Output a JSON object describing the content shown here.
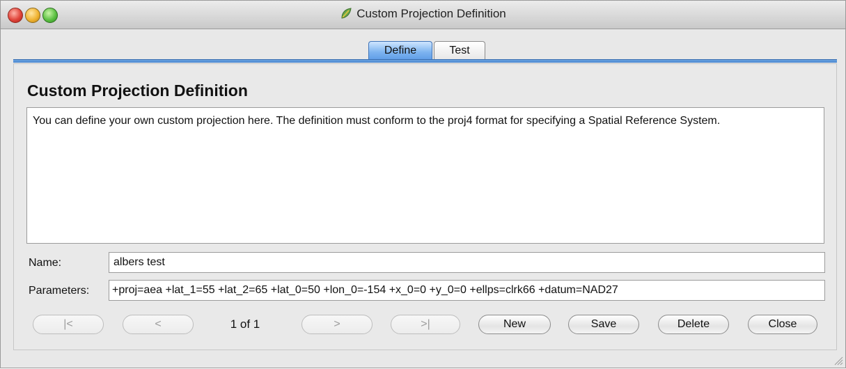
{
  "window": {
    "title": "Custom Projection Definition",
    "icon": "qgis-leaf-icon"
  },
  "tabs": [
    {
      "label": "Define",
      "selected": true
    },
    {
      "label": "Test",
      "selected": false
    }
  ],
  "heading": "Custom Projection Definition",
  "description": "You can define your own custom projection here. The definition must conform to the proj4 format for specifying a Spatial Reference System.",
  "fields": {
    "name_label": "Name:",
    "name_value": "albers test",
    "params_label": "Parameters:",
    "params_value": "+proj=aea +lat_1=55 +lat_2=65 +lat_0=50 +lon_0=-154 +x_0=0 +y_0=0 +ellps=clrk66 +datum=NAD27"
  },
  "navigation": {
    "first_label": "|<",
    "prev_label": "<",
    "record_counter": "1 of 1",
    "next_label": ">",
    "last_label": ">|"
  },
  "actions": {
    "new_label": "New",
    "save_label": "Save",
    "delete_label": "Delete",
    "close_label": "Close"
  },
  "colors": {
    "tab_accent": "#5c9ae6",
    "window_bg": "#e8e8e8"
  }
}
